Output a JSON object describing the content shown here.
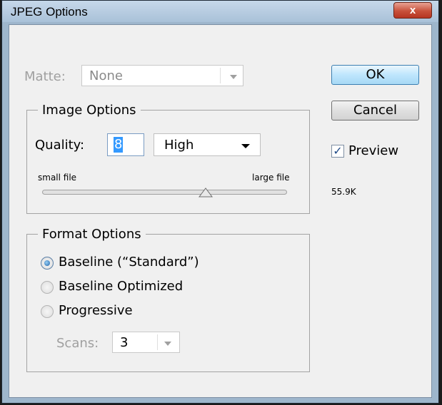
{
  "window": {
    "title": "JPEG Options",
    "close_glyph": "x"
  },
  "matte": {
    "label": "Matte:",
    "value": "None",
    "enabled": false
  },
  "image_options": {
    "legend": "Image Options",
    "quality_label": "Quality:",
    "quality_value": "8",
    "quality_preset": "High",
    "slider_min_label": "small file",
    "slider_max_label": "large file",
    "slider_value": 8,
    "slider_range": [
      0,
      12
    ]
  },
  "format_options": {
    "legend": "Format Options",
    "options": [
      {
        "label": "Baseline (“Standard”)",
        "selected": true
      },
      {
        "label": "Baseline Optimized",
        "selected": false
      },
      {
        "label": "Progressive",
        "selected": false
      }
    ],
    "scans_label": "Scans:",
    "scans_value": "3",
    "scans_enabled": false
  },
  "buttons": {
    "ok": "OK",
    "cancel": "Cancel"
  },
  "preview": {
    "label": "Preview",
    "checked": true,
    "file_size": "55.9K"
  },
  "icons": {
    "close": "close-icon",
    "dropdown": "chevron-down-icon",
    "check": "checkmark-icon",
    "slider_thumb": "slider-thumb-icon"
  },
  "colors": {
    "title_bar": "#a9c1d8",
    "close_button": "#c8503a",
    "default_button": "#bee6fd",
    "selection": "#3399ff"
  }
}
